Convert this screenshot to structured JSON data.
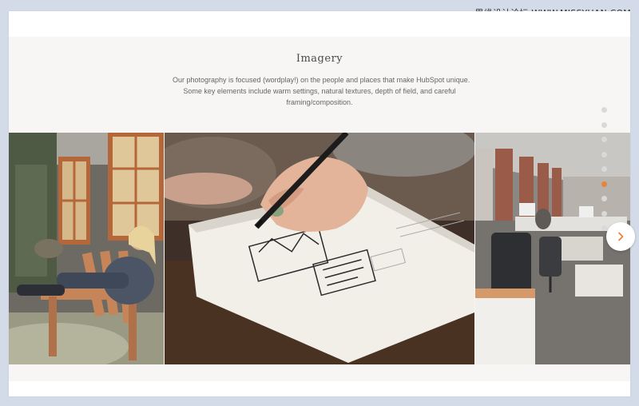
{
  "watermark": "思缘设计论坛 WWW.MISSYUAN.COM",
  "section": {
    "title": "Imagery",
    "description_lines": [
      "Our photography is focused (wordplay!) on the people and places that make HubSpot unique.",
      "Some key elements include warm settings, natural textures, depth of field, and careful",
      "framing/composition."
    ]
  },
  "carousel": {
    "dot_count": 9,
    "active_index": 5,
    "active_color": "#e8833a",
    "inactive_color": "#d9d9d9",
    "next_icon": "chevron-right-icon"
  },
  "photos": [
    {
      "subject": "woman-in-adirondack-chair"
    },
    {
      "subject": "hand-sketching-in-notebook"
    },
    {
      "subject": "open-office-workspace"
    }
  ]
}
